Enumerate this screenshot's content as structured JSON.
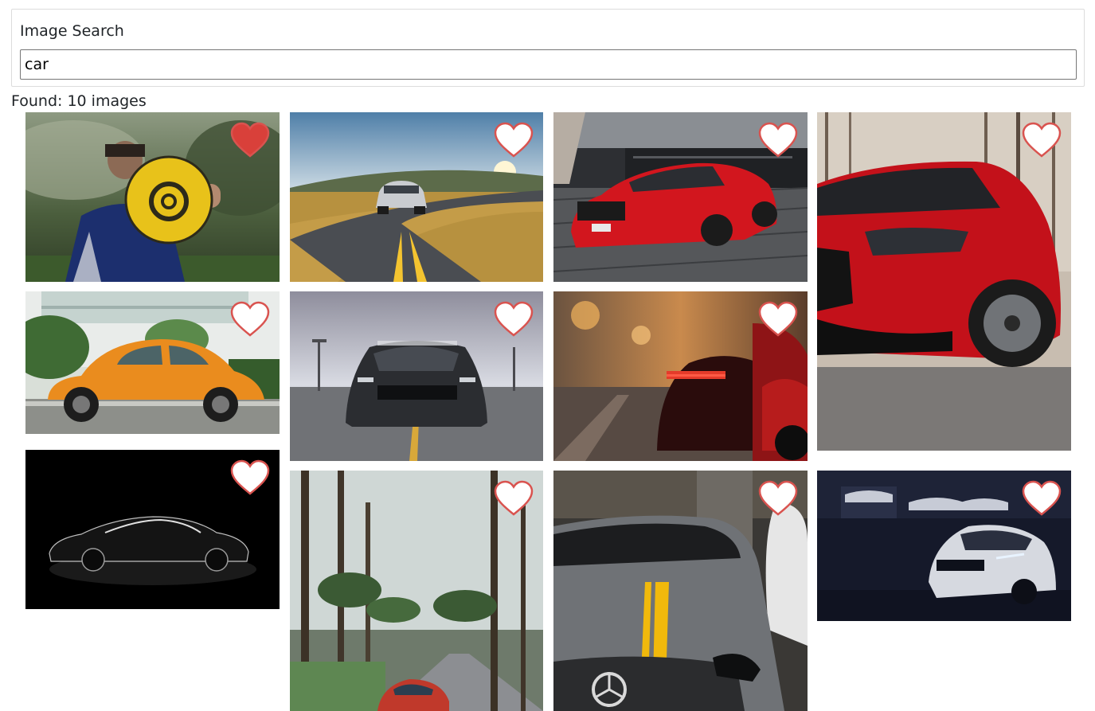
{
  "search": {
    "title": "Image Search",
    "query": "car"
  },
  "results": {
    "found_text": "Found: 10 images"
  },
  "colors": {
    "heart_stroke": "#d9534f",
    "heart_fill_favorite": "#d9403a",
    "heart_fill_default": "#ffffff"
  },
  "images": [
    {
      "subject": "person-holding-yellow-ball",
      "favorite": true
    },
    {
      "subject": "silver-car-on-winding-road",
      "favorite": false
    },
    {
      "subject": "red-mustang-on-cobblestones",
      "favorite": false
    },
    {
      "subject": "red-hatchback-front",
      "favorite": false
    },
    {
      "subject": "orange-beetle",
      "favorite": false
    },
    {
      "subject": "black-mustang-front",
      "favorite": false
    },
    {
      "subject": "red-sports-car-rear-city",
      "favorite": false
    },
    {
      "subject": "black-coupe-silhouette",
      "favorite": false
    },
    {
      "subject": "palm-street-red-car",
      "favorite": false
    },
    {
      "subject": "grey-mercedes-yellow-stripe",
      "favorite": false
    },
    {
      "subject": "white-camaro-garage",
      "favorite": false
    }
  ]
}
